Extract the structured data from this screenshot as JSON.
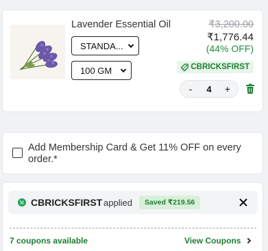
{
  "product": {
    "name": "Lavender Essential Oil",
    "image_icon": "lavender-image",
    "variant_selected": "STANDA...",
    "size_selected": "100 GM",
    "mrp": "₹3,200.00",
    "price": "₹1,776.44",
    "discount": "(44% OFF)",
    "coupon_code": "CBRICKSFIRST",
    "quantity": "4",
    "minus_label": "-",
    "plus_label": "+"
  },
  "membership": {
    "label": "Add Membership Card & Get 11% OFF on every order.*",
    "checked": false
  },
  "coupon": {
    "code": "CBRICKSFIRST",
    "applied_label": "applied",
    "saved_label": "Saved ₹219.56",
    "available_label": "7 coupons available",
    "view_label": "View Coupons"
  },
  "colors": {
    "accent_green": "#1e7d32",
    "discount_green": "#1e8e3e",
    "strike_gray": "#9aa0a6"
  }
}
